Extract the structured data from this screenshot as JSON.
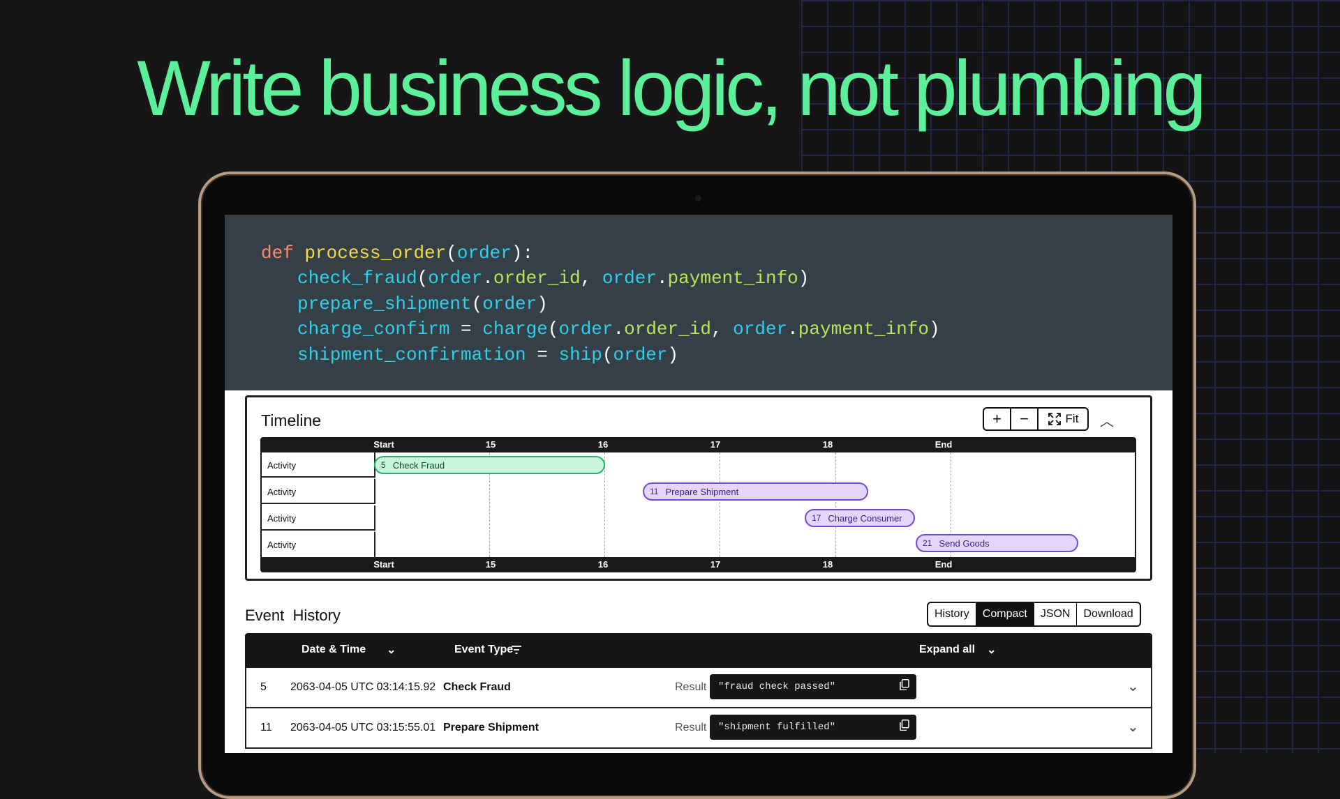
{
  "headline": "Write business logic, not plumbing",
  "code": {
    "line1": {
      "kw": "def",
      "fn": "process_order",
      "arg": "order"
    },
    "line2": {
      "fn": "check_fraud",
      "a": "order",
      "b": "order_id",
      "c": "order",
      "d": "payment_info"
    },
    "line3": {
      "fn": "prepare_shipment",
      "a": "order"
    },
    "line4": {
      "var": "charge_confirm",
      "fn": "charge",
      "a": "order",
      "b": "order_id",
      "c": "order",
      "d": "payment_info"
    },
    "line5": {
      "var": "shipment_confirmation",
      "fn": "ship",
      "a": "order"
    }
  },
  "timeline": {
    "title": "Timeline",
    "fit_label": "Fit",
    "ticks": [
      "Start",
      "15",
      "16",
      "17",
      "18",
      "End"
    ],
    "row_label": "Activity",
    "rows": [
      {
        "id": "5",
        "label": "Check Fraud",
        "color": "green"
      },
      {
        "id": "11",
        "label": "Prepare Shipment",
        "color": "purple"
      },
      {
        "id": "17",
        "label": "Charge Consumer",
        "color": "purple"
      },
      {
        "id": "21",
        "label": "Send Goods",
        "color": "purple"
      }
    ]
  },
  "event_history": {
    "title": "Event  History",
    "tabs": [
      "History",
      "Compact",
      "JSON",
      "Download"
    ],
    "active_tab": "Compact",
    "columns": {
      "date": "Date & Time",
      "type": "Event Type",
      "expand": "Expand all"
    },
    "rows": [
      {
        "id": "5",
        "date": "2063-04-05 UTC 03:14:15.92",
        "type": "Check Fraud",
        "result_label": "Result",
        "result": "\"fraud check passed\""
      },
      {
        "id": "11",
        "date": "2063-04-05 UTC 03:15:55.01",
        "type": "Prepare Shipment",
        "result_label": "Result",
        "result": "\"shipment fulfilled\""
      }
    ]
  },
  "colors": {
    "headline": "#5cf09a",
    "code_bg": "#343f47",
    "green": "#1eb86a",
    "purple": "#7448d8"
  }
}
